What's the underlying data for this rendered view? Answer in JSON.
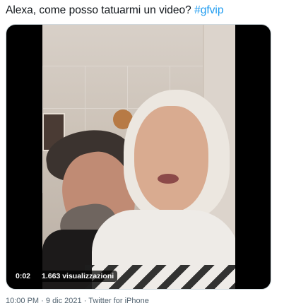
{
  "tweet": {
    "text": "Alexa, come posso tatuarmi un video?",
    "hashtag": "#gfvip"
  },
  "video": {
    "time": "0:02",
    "views": "1.663 visualizzazioni"
  },
  "meta": {
    "time": "10:00 PM",
    "separator": "·",
    "date": "9 dic 2021",
    "source": "Twitter for iPhone"
  }
}
